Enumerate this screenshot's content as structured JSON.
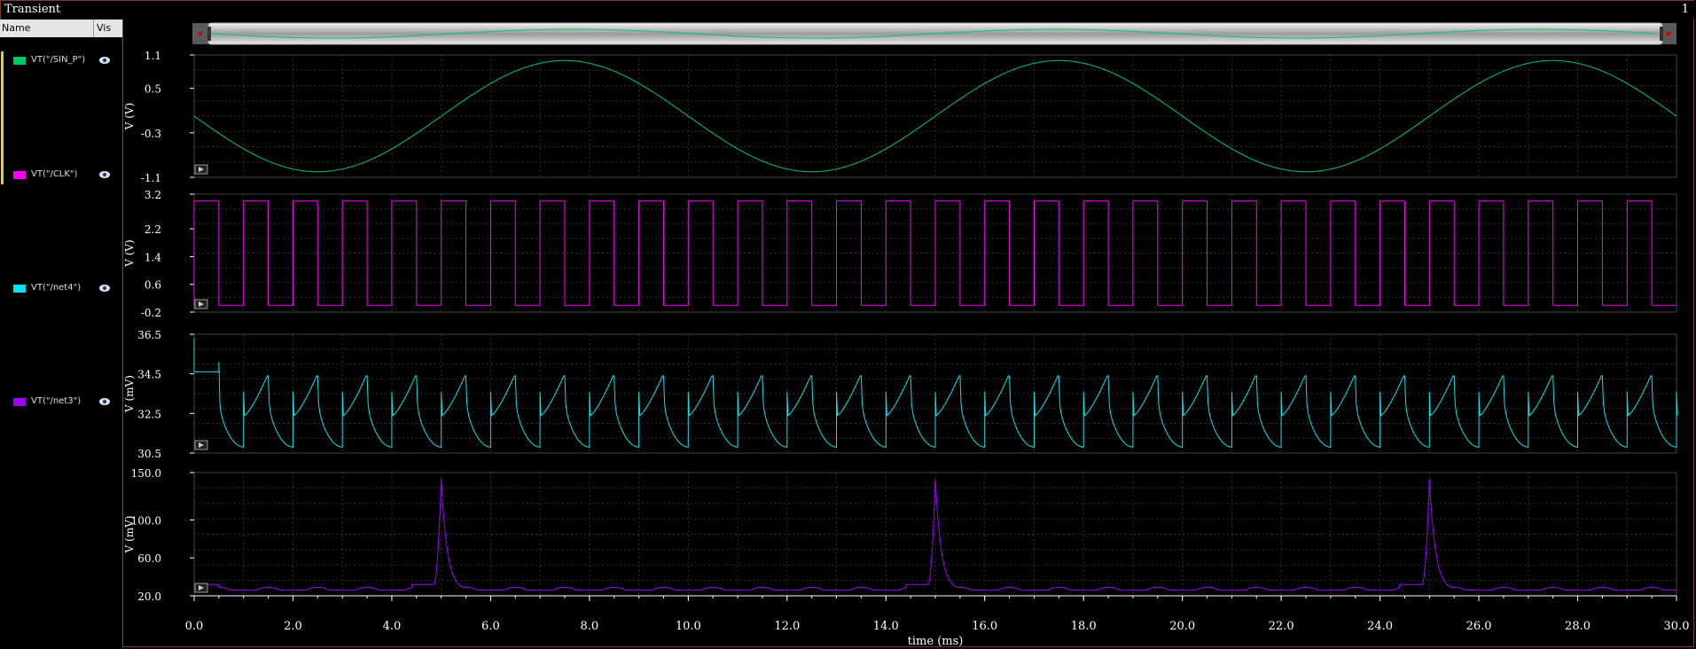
{
  "window": {
    "title": "Transient",
    "page_number": "1"
  },
  "panel": {
    "header": {
      "name": "Name",
      "vis": "Vis"
    },
    "signals": [
      {
        "label": "VT(\"/SIN_P\")",
        "color": "#00c860",
        "icon": "eye-icon"
      },
      {
        "label": "VT(\"/CLK\")",
        "color": "#ff00ff",
        "icon": "eye-icon"
      },
      {
        "label": "VT(\"/net4\")",
        "color": "#00e6f0",
        "icon": "eye-icon"
      },
      {
        "label": "VT(\"/net3\")",
        "color": "#a000ff",
        "icon": "eye-icon"
      }
    ]
  },
  "colors": {
    "background": "#000000",
    "grid": "#303030",
    "selection": "#f0d000"
  },
  "chart_data": {
    "type": "line",
    "xlabel": "time (ms)",
    "xlim": [
      0,
      30
    ],
    "xticks": [
      "0.0",
      "2.0",
      "4.0",
      "6.0",
      "8.0",
      "10.0",
      "12.0",
      "14.0",
      "16.0",
      "18.0",
      "20.0",
      "22.0",
      "24.0",
      "26.0",
      "28.0",
      "30.0"
    ],
    "subplots": [
      {
        "name": "VT(\"/SIN_P\")",
        "ylabel": "V (V)",
        "ylim": [
          -1.1,
          1.1
        ],
        "yticks": [
          "1.1",
          "0.5",
          "-0.3",
          "-1.1"
        ],
        "color": "#00c860",
        "waveform": "sine",
        "amplitude": 1.0,
        "offset": 0.0,
        "period_ms": 10.0,
        "phase_deg": 180
      },
      {
        "name": "VT(\"/CLK\")",
        "ylabel": "V (V)",
        "ylim": [
          -0.2,
          3.2
        ],
        "yticks": [
          "3.2",
          "2.2",
          "1.4",
          "0.6",
          "-0.2"
        ],
        "color": "#ff00ff",
        "waveform": "square",
        "high": 3.0,
        "low": 0.0,
        "period_ms": 1.0,
        "first_rise_ms": 0.0
      },
      {
        "name": "VT(\"/net4\")",
        "ylabel": "V (mV)",
        "ylim": [
          30.5,
          36.5
        ],
        "yticks": [
          "36.5",
          "34.5",
          "32.5",
          "30.5"
        ],
        "color": "#00e6f0",
        "waveform": "charge_discharge",
        "period_ms": 1.0,
        "peak": 34.4,
        "trough": 30.8,
        "initial_level": 34.6,
        "initial_spike": 36.3
      },
      {
        "name": "VT(\"/net3\")",
        "ylabel": "V (mV)",
        "ylim": [
          20.0,
          150.0
        ],
        "yticks": [
          "150.0",
          "100.0",
          "60.0",
          "20.0"
        ],
        "color": "#a000ff",
        "waveform": "baseline_spikes",
        "baseline": 26.0,
        "ripple": 3.0,
        "spikes": [
          {
            "t": 5.0,
            "v": 144
          },
          {
            "t": 15.0,
            "v": 143
          },
          {
            "t": 25.0,
            "v": 143
          }
        ]
      }
    ],
    "grid": true,
    "legend": "left-panel"
  }
}
